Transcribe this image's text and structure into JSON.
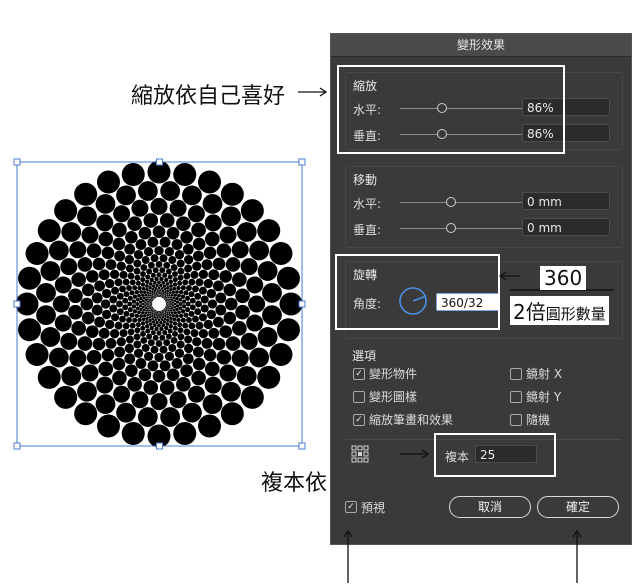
{
  "dialog": {
    "title": "變形效果",
    "scale": {
      "label": "縮放",
      "horizontal": {
        "label": "水平:",
        "value": "86%",
        "level": 0.86
      },
      "vertical": {
        "label": "垂直:",
        "value": "86%",
        "level": 0.86
      }
    },
    "move": {
      "label": "移動",
      "horizontal": {
        "label": "水平:",
        "value": "0 mm",
        "level": 0.5
      },
      "vertical": {
        "label": "垂直:",
        "value": "0 mm",
        "level": 0.5
      }
    },
    "rotate": {
      "label": "旋轉",
      "angle_label": "角度:",
      "angle_value": "360/32"
    },
    "options": {
      "label": "選項",
      "items": [
        {
          "label": "變形物件",
          "checked": true
        },
        {
          "label": "變形圖樣",
          "checked": false
        },
        {
          "label": "縮放筆畫和效果",
          "checked": true
        },
        {
          "label": "鏡射 X",
          "checked": false
        },
        {
          "label": "鏡射 Y",
          "checked": false
        },
        {
          "label": "隨機",
          "checked": false
        }
      ]
    },
    "copies": {
      "label": "複本",
      "value": "25"
    },
    "preview": {
      "label": "預視",
      "checked": true
    },
    "cancel_label": "取消",
    "ok_label": "確定"
  },
  "annotations": {
    "scale_note": "縮放依自己喜好",
    "copies_note": "複本依自己喜好",
    "fraction_top": "360",
    "fraction_bottom_big": "2倍",
    "fraction_bottom_small": "圓形數量"
  },
  "colors": {
    "dialog_bg": "#3a3a3a",
    "selection_blue": "#4a7bd0",
    "dial_blue": "#4a90e2",
    "dot": "#000000"
  }
}
